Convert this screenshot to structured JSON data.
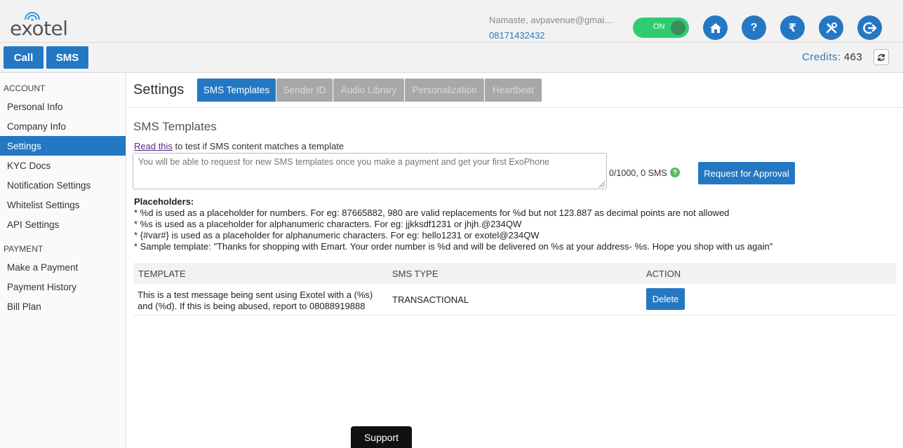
{
  "header": {
    "logo_text": "exotel",
    "greeting": "Namaste, avpavenue@gmai...",
    "phone": "08171432432",
    "toggle_label": "ON",
    "toggle_state": true,
    "icons": [
      "home-icon",
      "help-icon",
      "rupee-icon",
      "tools-icon",
      "logout-icon"
    ],
    "help_label": "?",
    "rupee_label": "₹",
    "call_label": "Call",
    "sms_label": "SMS",
    "credits_label": "Credits:",
    "credits_value": "463",
    "accent_color": "#2478c3",
    "toggle_color": "#2ecc71"
  },
  "sidebar": {
    "account_heading": "ACCOUNT",
    "account_items": [
      {
        "label": "Personal Info"
      },
      {
        "label": "Company Info"
      },
      {
        "label": "Settings",
        "active": true
      },
      {
        "label": "KYC Docs"
      },
      {
        "label": "Notification Settings"
      },
      {
        "label": "Whitelist Settings"
      },
      {
        "label": "API Settings"
      }
    ],
    "payment_heading": "PAYMENT",
    "payment_items": [
      {
        "label": "Make a Payment"
      },
      {
        "label": "Payment History"
      },
      {
        "label": "Bill Plan"
      }
    ]
  },
  "main": {
    "title": "Settings",
    "tabs": [
      {
        "label": "SMS Templates",
        "active": true
      },
      {
        "label": "Sender ID"
      },
      {
        "label": "Audio Library"
      },
      {
        "label": "Personalization"
      },
      {
        "label": "Heartbeat"
      }
    ],
    "section_heading": "SMS Templates",
    "read_link": "Read this",
    "read_rest": " to test if SMS content matches a template",
    "textarea_placeholder": "You will be able to request for new SMS templates once you make a payment and get your first ExoPhone",
    "count_text": "0/1000, 0 SMS",
    "help_badge": "?",
    "approve_label": "Request for Approval",
    "placeholders_title": "Placeholders:",
    "placeholder_lines": [
      "* %d is used as a placeholder for numbers. For eg: 87665882, 980 are valid replacements for %d but not 123.887 as decimal points are not allowed",
      "* %s is used as a placeholder for alphanumeric characters. For eg: jjkksdf1231 or jhjh.@234QW",
      "* {#var#} is used as a placeholder for alphanumeric characters. For eg: hello1231 or exotel@234QW",
      "* Sample template: \"Thanks for shopping with Emart. Your order number is %d and will be delivered on %s at your address- %s. Hope you shop with us again\""
    ],
    "table": {
      "headers": [
        "TEMPLATE",
        "SMS TYPE",
        "ACTION"
      ],
      "rows": [
        {
          "template_line1": "This is a test message being sent using Exotel with a (%s)",
          "template_line2": "and (%d). If this is being abused, report to 08088919888",
          "sms_type": "TRANSACTIONAL",
          "action": "Delete"
        }
      ]
    }
  },
  "footer": {
    "support_label": "Support"
  }
}
